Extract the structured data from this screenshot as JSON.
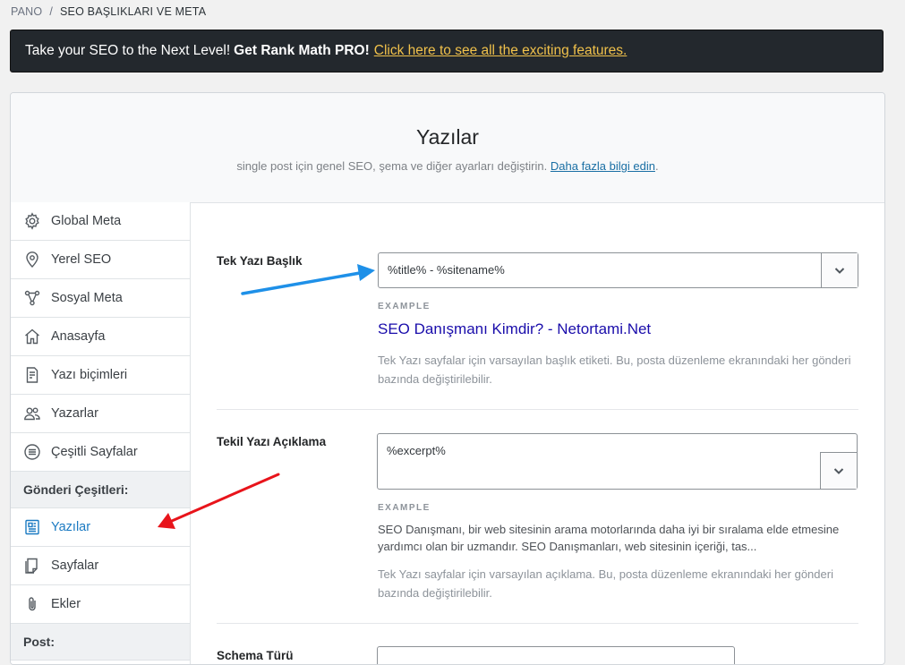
{
  "breadcrumb": {
    "home": "PANO",
    "separator": "/",
    "current": "SEO BAŞLIKLARI VE META"
  },
  "promo": {
    "lead": "Take your SEO to the Next Level!",
    "strong": "Get Rank Math PRO!",
    "link": "Click here to see all the exciting features."
  },
  "header": {
    "title": "Yazılar",
    "subtitle": "single post için genel SEO, şema ve diğer ayarları değiştirin.",
    "link": "Daha fazla bilgi edin",
    "link_suffix": "."
  },
  "sidebar": {
    "items": [
      {
        "label": "Global Meta",
        "icon": "gear-icon"
      },
      {
        "label": "Yerel SEO",
        "icon": "map-pin-icon"
      },
      {
        "label": "Sosyal Meta",
        "icon": "share-nodes-icon"
      },
      {
        "label": "Anasayfa",
        "icon": "home-icon"
      },
      {
        "label": "Yazı biçimleri",
        "icon": "document-icon"
      },
      {
        "label": "Yazarlar",
        "icon": "users-icon"
      },
      {
        "label": "Çeşitli Sayfalar",
        "icon": "list-circle-icon"
      }
    ],
    "group1": "Gönderi Çeşitleri:",
    "post_types": [
      {
        "label": "Yazılar",
        "icon": "post-icon",
        "active": true
      },
      {
        "label": "Sayfalar",
        "icon": "page-icon"
      },
      {
        "label": "Ekler",
        "icon": "paperclip-icon"
      }
    ],
    "group2": "Post:"
  },
  "fields": {
    "title": {
      "label": "Tek Yazı Başlık",
      "value": "%title% - %sitename%",
      "example_label": "EXAMPLE",
      "preview": "SEO Danışmanı Kimdir? - Netortami.Net",
      "help": "Tek Yazı sayfalar için varsayılan başlık etiketi. Bu, posta düzenleme ekranındaki her gönderi bazında değiştirilebilir."
    },
    "description": {
      "label": "Tekil Yazı Açıklama",
      "value": "%excerpt%",
      "example_label": "EXAMPLE",
      "preview": "SEO Danışmanı, bir web sitesinin arama motorlarında daha iyi bir sıralama elde etmesine yardımcı olan bir uzmandır. SEO Danışmanları, web sitesinin içeriği, tas...",
      "help": "Tek Yazı sayfalar için varsayılan açıklama. Bu, posta düzenleme ekranındaki her gönderi bazında değiştirilebilir."
    },
    "schema": {
      "label": "Schema Türü"
    }
  },
  "colors": {
    "accent": "#1b7ac2",
    "promo_bg": "#23282d",
    "promo_link": "#f0c14b",
    "arrow_blue": "#1e90e8",
    "arrow_red": "#e8141b"
  }
}
